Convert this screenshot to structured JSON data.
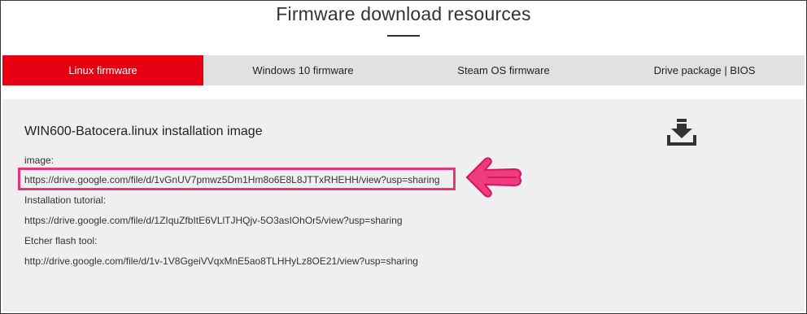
{
  "page": {
    "title": "Firmware download resources"
  },
  "tabs": [
    {
      "label": "Linux firmware",
      "active": true
    },
    {
      "label": "Windows 10 firmware",
      "active": false
    },
    {
      "label": "Steam OS firmware",
      "active": false
    },
    {
      "label": "Drive package | BIOS",
      "active": false
    }
  ],
  "panel": {
    "title": "WIN600-Batocera.linux installation image",
    "image_label": "image:",
    "image_link": "https://drive.google.com/file/d/1vGnUV7pmwz5Dm1Hm8o6E8L8JTTxRHEHH/view?usp=sharing",
    "tutorial_label": "Installation tutorial:",
    "tutorial_link": "https://drive.google.com/file/d/1ZIquZfbItE6VLlTJHQjv-5O3asIOhOr5/view?usp=sharing",
    "etcher_label": "Etcher flash tool:",
    "etcher_link": "http://drive.google.com/file/d/1v-1V8GgeiVVqxMnE5ao8TLHHyLz8OE21/view?usp=sharing",
    "download_icon": "download-icon"
  },
  "colors": {
    "accent": "#e60012",
    "highlight": "#e8347a",
    "tab_bg": "#e1e1e1",
    "panel_bg": "#efefef"
  }
}
